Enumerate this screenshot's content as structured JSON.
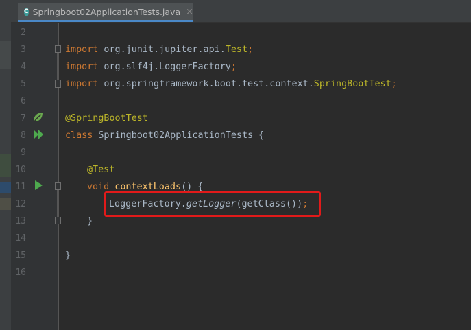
{
  "tab": {
    "label": "Springboot02ApplicationTests.java",
    "icon": "java-class-icon",
    "close": "×"
  },
  "lines": [
    {
      "n": "2"
    },
    {
      "n": "3"
    },
    {
      "n": "4"
    },
    {
      "n": "5"
    },
    {
      "n": "6"
    },
    {
      "n": "7"
    },
    {
      "n": "8"
    },
    {
      "n": "9"
    },
    {
      "n": "10"
    },
    {
      "n": "11"
    },
    {
      "n": "12"
    },
    {
      "n": "13"
    },
    {
      "n": "14"
    },
    {
      "n": "15"
    },
    {
      "n": "16"
    }
  ],
  "code": {
    "l3": {
      "kw": "import",
      "pkg": " org.junit.jupiter.api.",
      "cls": "Test",
      "semi": ";"
    },
    "l4": {
      "kw": "import",
      "pkg": " org.slf4j.LoggerFactory",
      "semi": ";"
    },
    "l5": {
      "kw": "import",
      "pkg": " org.springframework.boot.test.context.",
      "cls": "SpringBootTest",
      "semi": ";"
    },
    "l7": {
      "ann": "@SpringBootTest"
    },
    "l8": {
      "kw": "class",
      "name": " Springboot02ApplicationTests ",
      "brace": "{"
    },
    "l10": {
      "ann": "@Test"
    },
    "l11": {
      "kw": "void",
      "fn": " contextLoads",
      "rest": "() {"
    },
    "l12": {
      "cls": "LoggerFactory.",
      "method": "getLogger",
      "rest": "(getClass())",
      "semi": ";"
    },
    "l13": {
      "brace": "}"
    },
    "l15": {
      "brace": "}"
    }
  },
  "colors": {
    "keyword": "#cc7832",
    "annotation": "#bbb529",
    "function": "#ffc66d",
    "text": "#a9b7c6",
    "highlight": "#e11a1a"
  }
}
